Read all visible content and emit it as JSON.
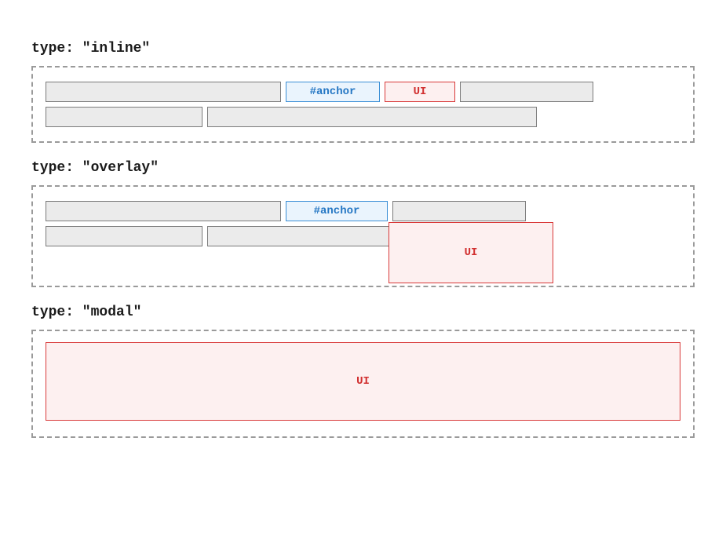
{
  "inline": {
    "label": "type: \"inline\"",
    "anchor_text": "#anchor",
    "ui_text": "UI"
  },
  "overlay": {
    "label": "type: \"overlay\"",
    "anchor_text": "#anchor",
    "ui_text": "UI"
  },
  "modal": {
    "label": "type: \"modal\"",
    "ui_text": "UI"
  }
}
